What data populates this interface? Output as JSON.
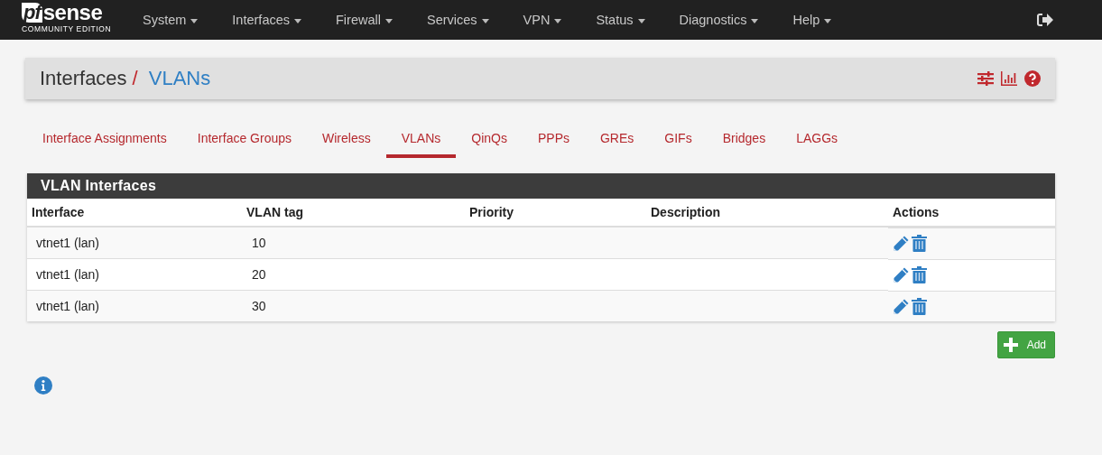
{
  "logo": {
    "mark": "pf",
    "word": "sense",
    "edition": "COMMUNITY EDITION"
  },
  "nav": [
    {
      "label": "System"
    },
    {
      "label": "Interfaces"
    },
    {
      "label": "Firewall"
    },
    {
      "label": "Services"
    },
    {
      "label": "VPN"
    },
    {
      "label": "Status"
    },
    {
      "label": "Diagnostics"
    },
    {
      "label": "Help"
    }
  ],
  "breadcrumb": {
    "parent": "Interfaces",
    "separator": "/",
    "current": "VLANs"
  },
  "tabs": [
    {
      "label": "Interface Assignments",
      "selected": false
    },
    {
      "label": "Interface Groups",
      "selected": false
    },
    {
      "label": "Wireless",
      "selected": false
    },
    {
      "label": "VLANs",
      "selected": true
    },
    {
      "label": "QinQs",
      "selected": false
    },
    {
      "label": "PPPs",
      "selected": false
    },
    {
      "label": "GREs",
      "selected": false
    },
    {
      "label": "GIFs",
      "selected": false
    },
    {
      "label": "Bridges",
      "selected": false
    },
    {
      "label": "LAGGs",
      "selected": false
    }
  ],
  "table": {
    "title": "VLAN Interfaces",
    "columns": [
      "Interface",
      "VLAN tag",
      "Priority",
      "Description",
      "Actions"
    ],
    "rows": [
      {
        "interface": "vtnet1 (lan)",
        "tag": "10"
      },
      {
        "interface": "vtnet1 (lan)",
        "tag": "20"
      },
      {
        "interface": "vtnet1 (lan)",
        "tag": "30"
      }
    ]
  },
  "add_button": "Add"
}
